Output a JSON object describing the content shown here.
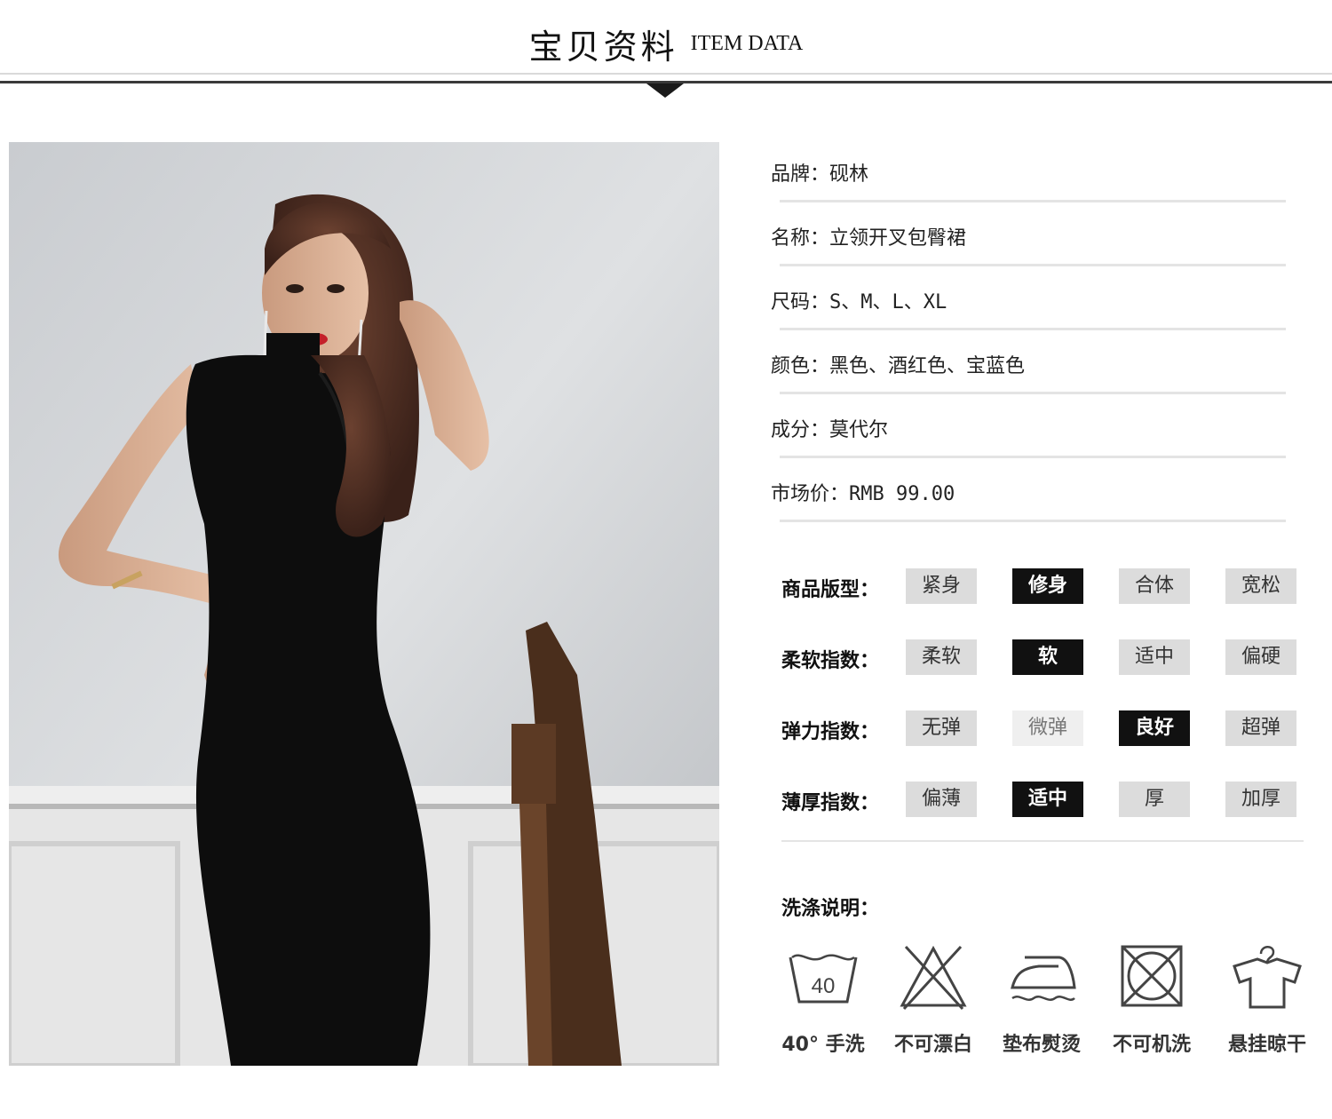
{
  "header": {
    "title_cn": "宝贝资料",
    "title_en": "ITEM DATA"
  },
  "details": [
    {
      "label": "品牌：",
      "value": "砚林"
    },
    {
      "label": "名称：",
      "value": "立领开叉包臀裙"
    },
    {
      "label": "尺码：",
      "value": "S、M、L、XL"
    },
    {
      "label": "颜色：",
      "value": "黑色、酒红色、宝蓝色"
    },
    {
      "label": "成分：",
      "value": "莫代尔"
    },
    {
      "label": "市场价：",
      "value": "RMB 99.00"
    }
  ],
  "scales": [
    {
      "label": "商品版型：",
      "options": [
        "紧身",
        "修身",
        "合体",
        "宽松"
      ],
      "selected": "修身"
    },
    {
      "label": "柔软指数：",
      "options": [
        "柔软",
        "软",
        "适中",
        "偏硬"
      ],
      "selected": "软"
    },
    {
      "label": "弹力指数：",
      "options": [
        "无弹",
        "微弹",
        "良好",
        "超弹"
      ],
      "selected": "良好"
    },
    {
      "label": "薄厚指数：",
      "options": [
        "偏薄",
        "适中",
        "厚",
        "加厚"
      ],
      "selected": "适中"
    }
  ],
  "care": {
    "title": "洗涤说明：",
    "items": [
      {
        "icon": "wash-tub-40-icon",
        "label": "40° 手洗",
        "tub_text": "40"
      },
      {
        "icon": "no-bleach-icon",
        "label": "不可漂白"
      },
      {
        "icon": "iron-with-cloth-icon",
        "label": "垫布熨烫"
      },
      {
        "icon": "no-tumble-dry-icon",
        "label": "不可机洗"
      },
      {
        "icon": "hang-dry-icon",
        "label": "悬挂晾干"
      }
    ]
  },
  "colors": {
    "accent": "#111111",
    "chip": "#dcdcdc",
    "chip_light": "#efefef",
    "rule": "#e4e4e4"
  }
}
